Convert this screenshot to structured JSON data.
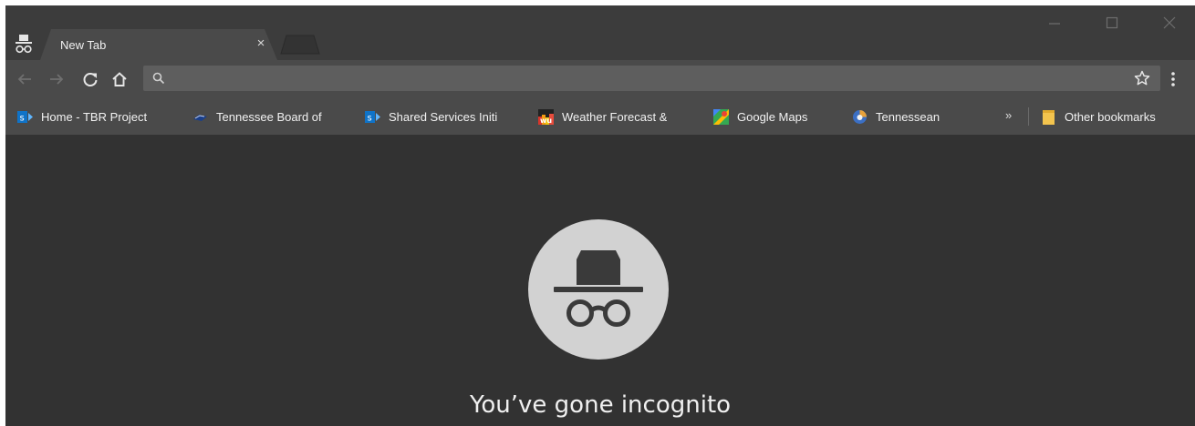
{
  "window": {
    "controls": [
      "minimize",
      "maximize",
      "close"
    ]
  },
  "tab": {
    "title": "New Tab",
    "close_glyph": "×"
  },
  "toolbar": {
    "omnibox_value": "",
    "icons": [
      "back-arrow-icon",
      "forward-arrow-icon",
      "reload-icon",
      "home-icon",
      "search-icon",
      "bookmark-star-icon",
      "menu-icon"
    ]
  },
  "bookmarks": {
    "items": [
      {
        "label": "Home - TBR Project",
        "icon": "sharepoint-favicon"
      },
      {
        "label": "Tennessee Board of",
        "icon": "tbr-favicon"
      },
      {
        "label": "Shared Services Initi",
        "icon": "sharepoint-favicon"
      },
      {
        "label": "Weather Forecast &",
        "icon": "wunderground-favicon"
      },
      {
        "label": "Google Maps",
        "icon": "google-maps-favicon"
      },
      {
        "label": "Tennessean",
        "icon": "tennessean-favicon"
      }
    ],
    "overflow": "»",
    "other": "Other bookmarks"
  },
  "content": {
    "heading": "You’ve gone incognito"
  },
  "colors": {
    "frame": "#3c3c3c",
    "toolbar": "#4a4a4a",
    "page": "#323232",
    "icon_circle": "#d2d2d2"
  }
}
